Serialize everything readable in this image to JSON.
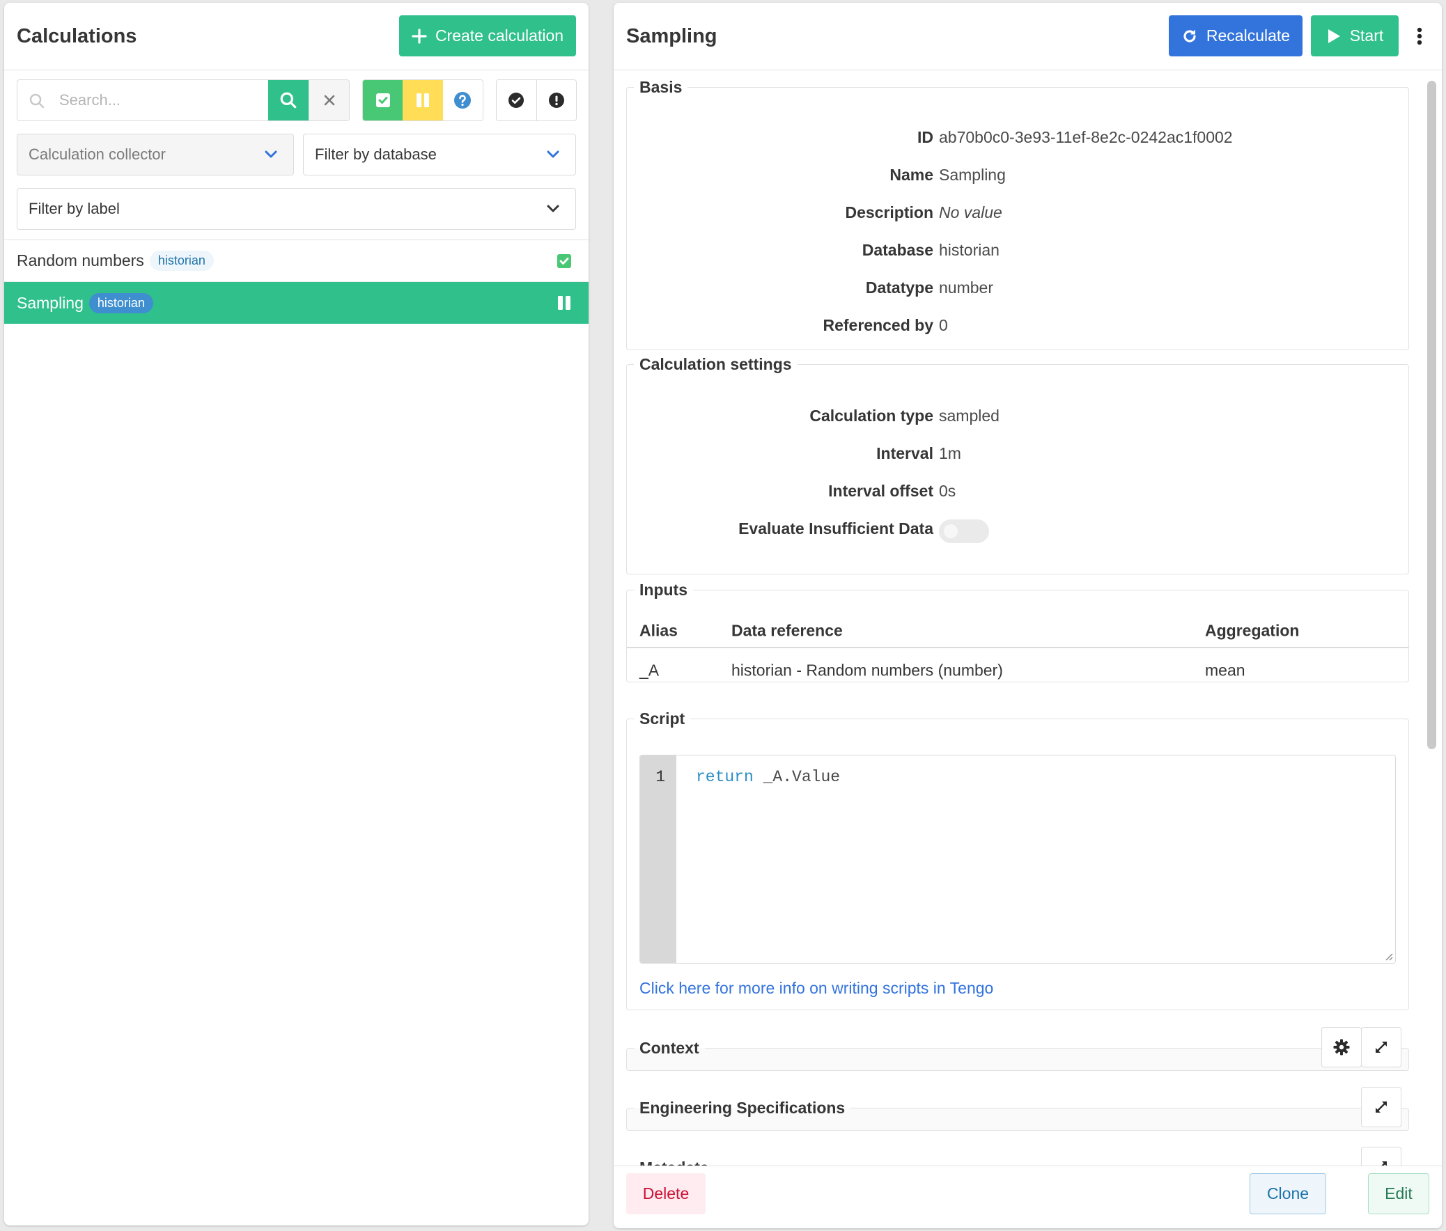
{
  "left": {
    "title": "Calculations",
    "create_label": "Create calculation",
    "search_placeholder": "Search...",
    "collector_placeholder": "Calculation collector",
    "database_placeholder": "Filter by database",
    "label_placeholder": "Filter by label",
    "items": [
      {
        "name": "Random numbers",
        "tag": "historian",
        "state": "enabled"
      },
      {
        "name": "Sampling",
        "tag": "historian",
        "state": "paused"
      }
    ]
  },
  "right": {
    "title": "Sampling",
    "recalculate_label": "Recalculate",
    "start_label": "Start",
    "basis": {
      "title": "Basis",
      "id_key": "ID",
      "id_val": "ab70b0c0-3e93-11ef-8e2c-0242ac1f0002",
      "name_key": "Name",
      "name_val": "Sampling",
      "desc_key": "Description",
      "desc_val": "No value",
      "db_key": "Database",
      "db_val": "historian",
      "dtype_key": "Datatype",
      "dtype_val": "number",
      "ref_key": "Referenced by",
      "ref_val": "0"
    },
    "settings": {
      "title": "Calculation settings",
      "type_key": "Calculation type",
      "type_val": "sampled",
      "interval_key": "Interval",
      "interval_val": "1m",
      "offset_key": "Interval offset",
      "offset_val": "0s",
      "insufficient_key": "Evaluate Insufficient Data",
      "insufficient_enabled": false
    },
    "inputs": {
      "title": "Inputs",
      "headers": [
        "Alias",
        "Data reference",
        "Aggregation"
      ],
      "rows": [
        {
          "alias": "_A",
          "ref": "historian - Random numbers (number)",
          "agg": "mean"
        }
      ]
    },
    "script": {
      "title": "Script",
      "line_no": "1",
      "keyword": "return",
      "rest": " _A.Value",
      "link": "Click here for more info on writing scripts in Tengo"
    },
    "context_title": "Context",
    "engineering_title": "Engineering Specifications",
    "metadata_title": "Metadata",
    "delete_label": "Delete",
    "clone_label": "Clone",
    "edit_label": "Edit"
  },
  "colors": {
    "primary_green": "#2fc08c",
    "primary_blue": "#3273dc",
    "status_enabled": "#48c774",
    "status_paused": "#ffdd57",
    "status_unknown": "#3e8ed0",
    "danger": "#cc0f35"
  }
}
